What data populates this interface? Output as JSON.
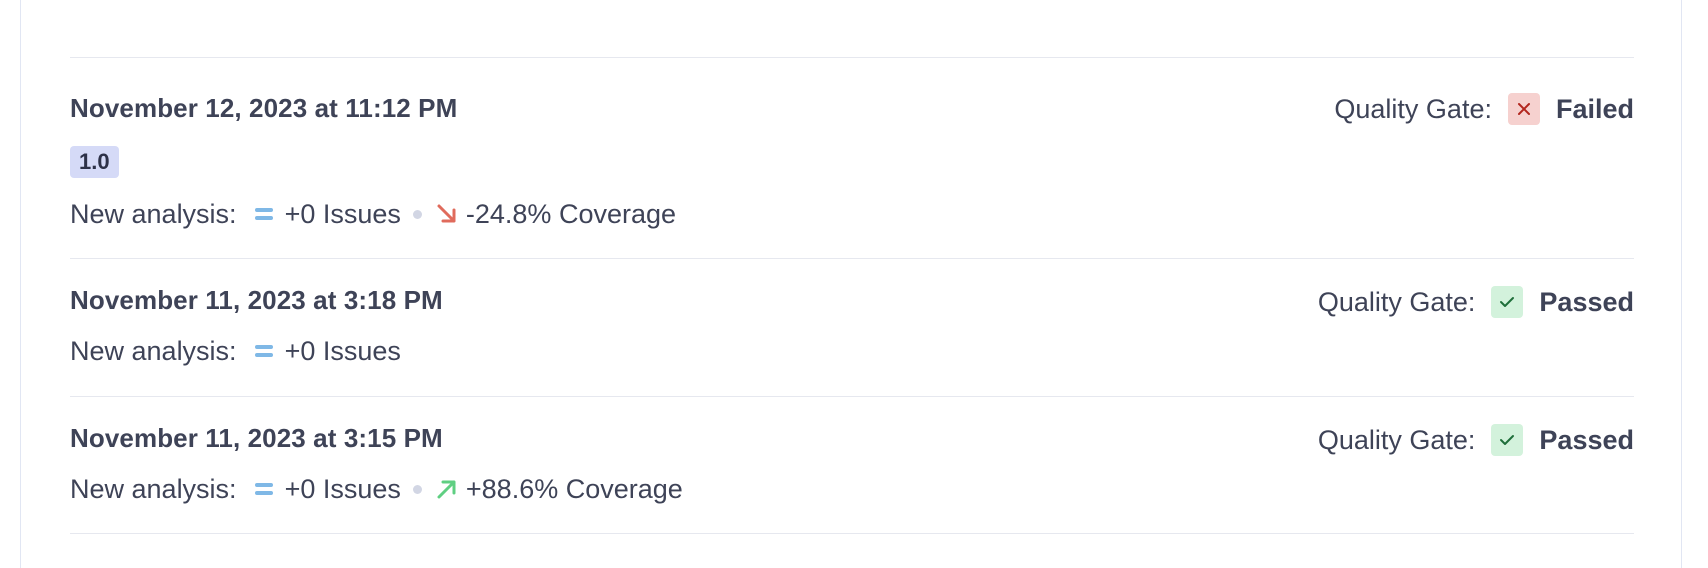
{
  "analyses": [
    {
      "date": "November 12, 2023 at 11:12 PM",
      "version": "1.0",
      "new_analysis_label": "New analysis:",
      "issues": "+0 Issues",
      "coverage": "-24.8% Coverage",
      "coverage_trend": "down",
      "quality_gate_label": "Quality Gate:",
      "quality_gate_status": "Failed"
    },
    {
      "date": "November 11, 2023 at 3:18 PM",
      "new_analysis_label": "New analysis:",
      "issues": "+0 Issues",
      "quality_gate_label": "Quality Gate:",
      "quality_gate_status": "Passed"
    },
    {
      "date": "November 11, 2023 at 3:15 PM",
      "new_analysis_label": "New analysis:",
      "issues": "+0 Issues",
      "coverage": "+88.6% Coverage",
      "coverage_trend": "up",
      "quality_gate_label": "Quality Gate:",
      "quality_gate_status": "Passed"
    }
  ],
  "colors": {
    "failed_bg": "#f6d1cf",
    "failed_icon": "#b3261e",
    "passed_bg": "#d3f2dc",
    "passed_icon": "#1f6f3a",
    "trend_down": "#e06b5c",
    "trend_up": "#5fcf82",
    "equal": "#7fb8e6"
  },
  "icons": {
    "failed": "close-icon",
    "passed": "check-icon",
    "down": "arrow-down-right-icon",
    "up": "arrow-up-right-icon",
    "equal": "equal-icon"
  }
}
